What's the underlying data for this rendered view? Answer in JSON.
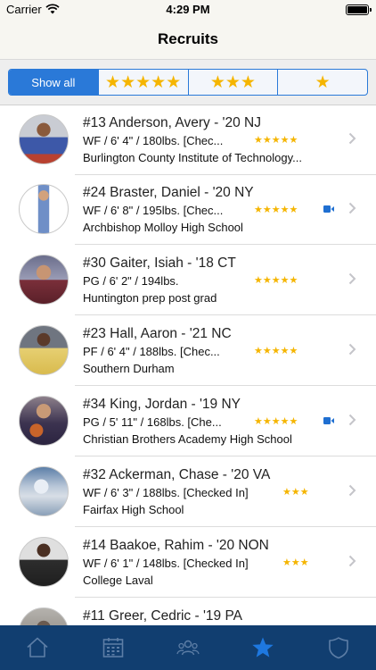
{
  "status_bar": {
    "carrier": "Carrier",
    "time": "4:29 PM"
  },
  "nav": {
    "title": "Recruits"
  },
  "filters": {
    "active_color": "#2a79d8",
    "star_color": "#f5b500",
    "segments": [
      {
        "label": "Show all",
        "stars": 0,
        "selected": true
      },
      {
        "label": "★★★★★",
        "stars": 5,
        "selected": false
      },
      {
        "label": "★★★",
        "stars": 3,
        "selected": false
      },
      {
        "label": "★",
        "stars": 1,
        "selected": false
      }
    ]
  },
  "recruits": [
    {
      "title": "#13 Anderson, Avery - '20 NJ",
      "details": "WF / 6' 4\" / 180lbs. [Chec...",
      "stars": "★★★★★",
      "rating": 5,
      "school": "Burlington County Institute of Technology...",
      "video": false
    },
    {
      "title": "#24 Braster, Daniel - '20 NY",
      "details": "WF / 6' 8\" / 195lbs. [Chec...",
      "stars": "★★★★★",
      "rating": 5,
      "school": "Archbishop Molloy High School",
      "video": true
    },
    {
      "title": "#30 Gaiter, Isiah - '18 CT",
      "details": "PG / 6' 2\" / 194lbs.",
      "stars": "★★★★★",
      "rating": 5,
      "school": "Huntington prep post grad",
      "video": false
    },
    {
      "title": "#23 Hall, Aaron - '21 NC",
      "details": "PF / 6' 4\" / 188lbs. [Chec...",
      "stars": "★★★★★",
      "rating": 5,
      "school": "Southern Durham",
      "video": false
    },
    {
      "title": "#34 King, Jordan - '19 NY",
      "details": "PG / 5' 11\" / 168lbs. [Che...",
      "stars": "★★★★★",
      "rating": 5,
      "school": "Christian Brothers Academy High School",
      "video": true
    },
    {
      "title": "#32 Ackerman, Chase - '20 VA",
      "details": "WF / 6' 3\" / 188lbs. [Checked In]",
      "stars": "★★★",
      "rating": 3,
      "school": "Fairfax High School",
      "video": false
    },
    {
      "title": "#14 Baakoe, Rahim - '20 NON",
      "details": "WF / 6' 1\" / 148lbs. [Checked In]",
      "stars": "★★★",
      "rating": 3,
      "school": "College Laval",
      "video": false
    },
    {
      "title": "#11 Greer, Cedric - '19 PA",
      "details": "",
      "stars": "",
      "rating": 0,
      "school": "",
      "video": false
    }
  ],
  "tab_bar": {
    "background": "#113e70",
    "tabs": [
      {
        "icon": "home-icon",
        "selected": false
      },
      {
        "icon": "calendar-icon",
        "selected": false
      },
      {
        "icon": "people-icon",
        "selected": false
      },
      {
        "icon": "star-icon",
        "selected": true
      },
      {
        "icon": "shield-icon",
        "selected": false
      }
    ]
  }
}
